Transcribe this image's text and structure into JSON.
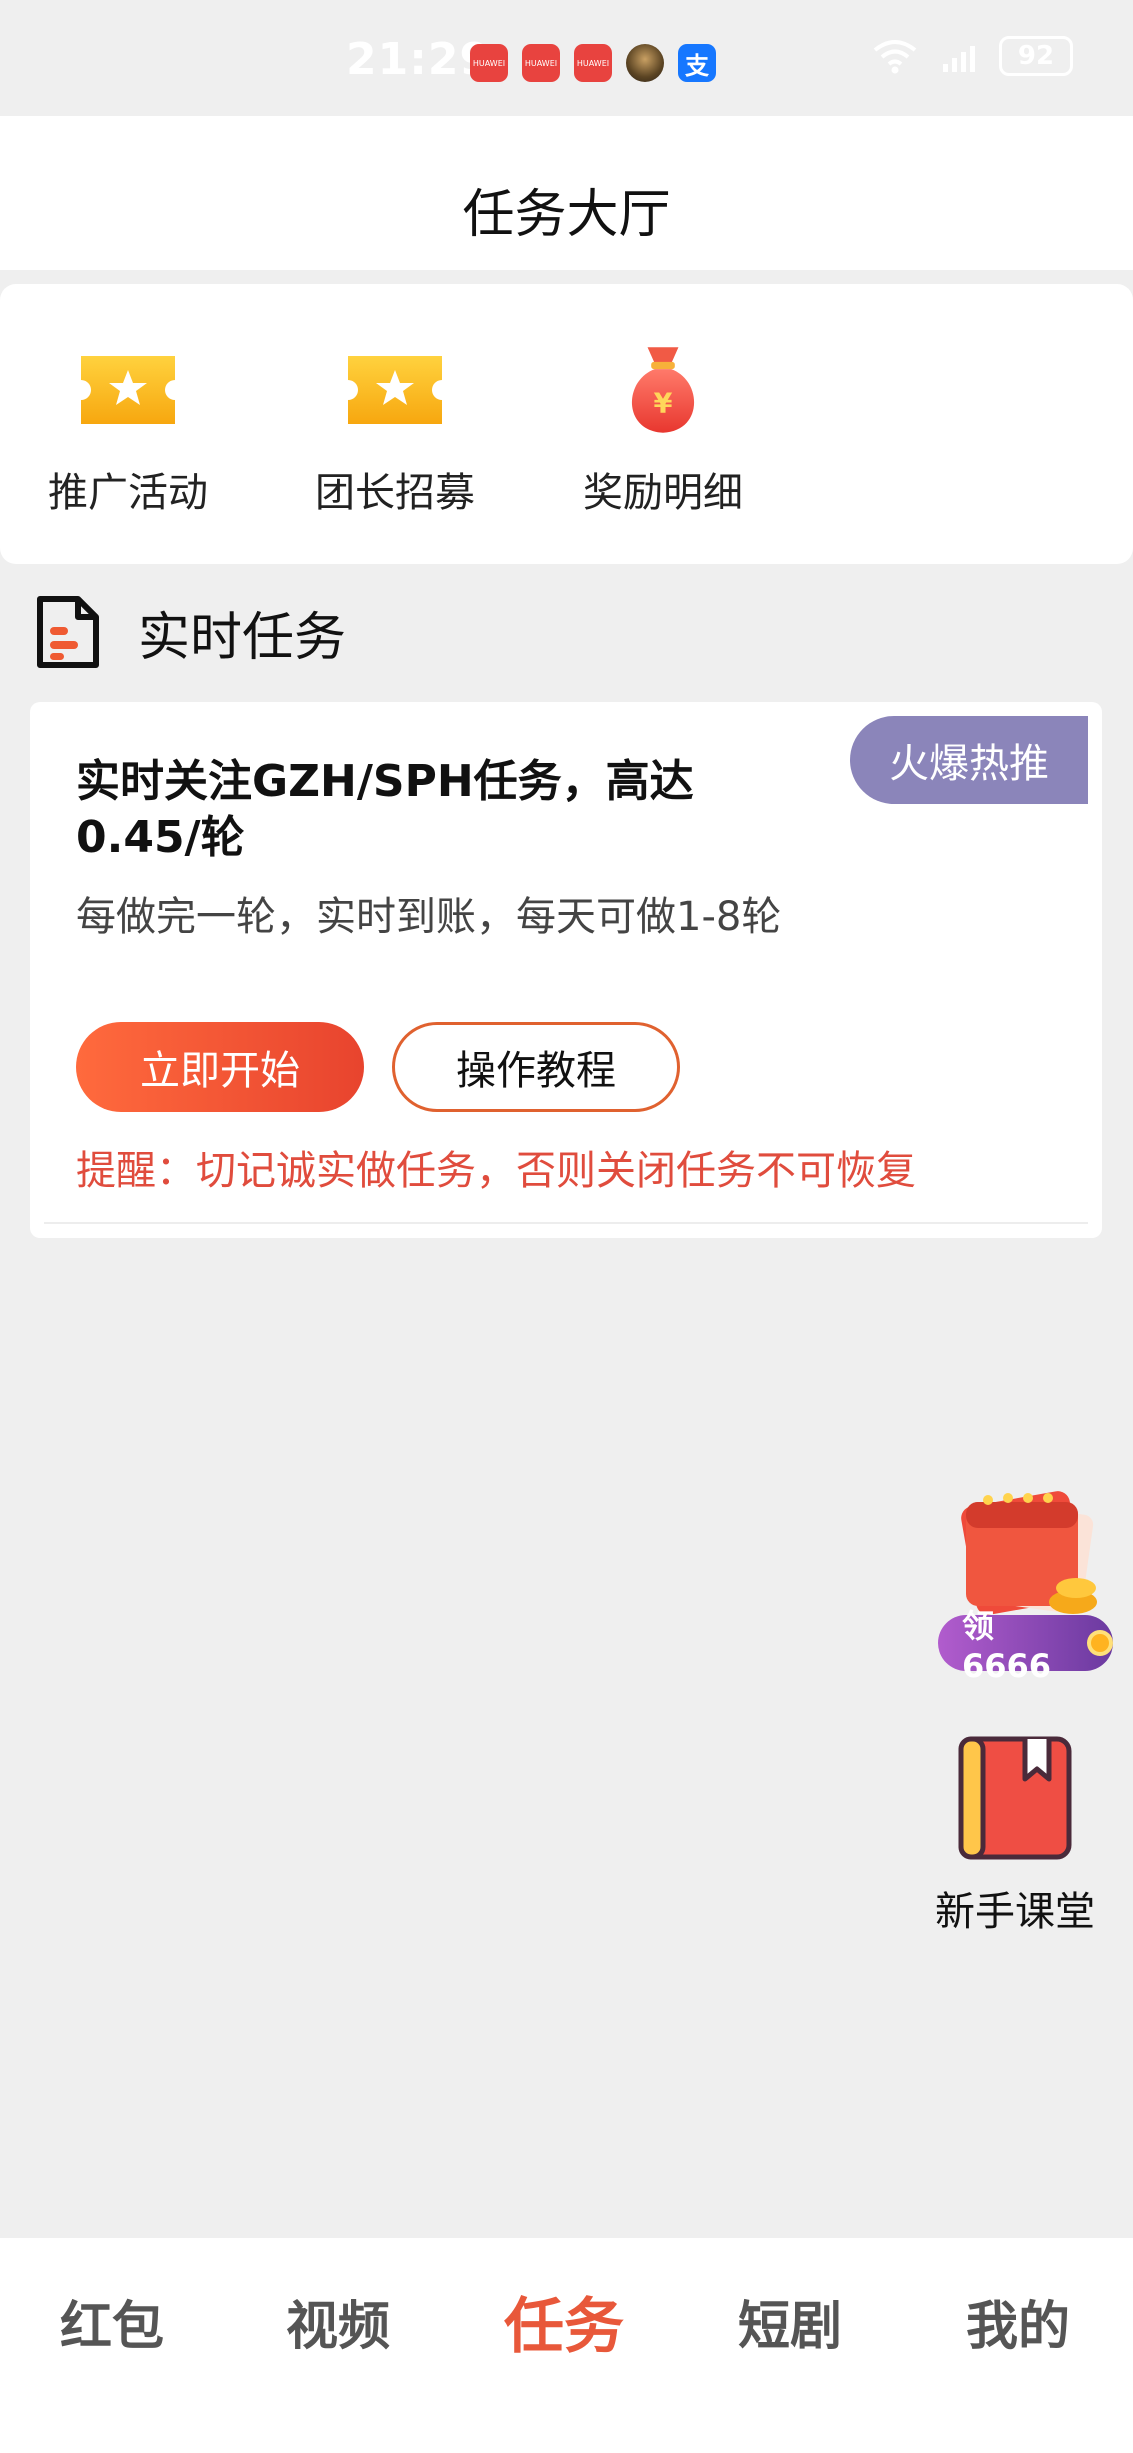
{
  "status_bar": {
    "time": "21:29",
    "apps": [
      "huawei-app-icon",
      "huawei-app-icon",
      "huawei-app-icon",
      "avatar-app-icon",
      "alipay-app-icon"
    ],
    "app_labels": [
      "HUAWEI",
      "HUAWEI",
      "HUAWEI",
      "",
      "支"
    ],
    "battery": "92"
  },
  "header": {
    "title": "任务大厅"
  },
  "entries": [
    {
      "label": "推广活动",
      "icon": "ticket-star-icon"
    },
    {
      "label": "团长招募",
      "icon": "ticket-star-icon"
    },
    {
      "label": "奖励明细",
      "icon": "money-bag-icon"
    }
  ],
  "section": {
    "title": "实时任务",
    "icon": "document-icon"
  },
  "task": {
    "badge": "火爆热推",
    "title": "实时关注GZH/SPH任务，高达0.45/轮",
    "description": "每做完一轮，实时到账，每天可做1-8轮",
    "start_label": "立即开始",
    "tutorial_label": "操作教程",
    "reminder": "提醒：切记诚实做任务，否则关闭任务不可恢复"
  },
  "floating": {
    "calendar_claim": "领6666",
    "guide_label": "新手课堂"
  },
  "nav": {
    "items": [
      {
        "label": "红包",
        "active": false
      },
      {
        "label": "视频",
        "active": false
      },
      {
        "label": "任务",
        "active": true
      },
      {
        "label": "短剧",
        "active": false
      },
      {
        "label": "我的",
        "active": false
      }
    ]
  },
  "colors": {
    "accent": "#e8583a",
    "badge": "#8b85ba",
    "reminder": "#e04c3d",
    "background": "#efefef"
  }
}
